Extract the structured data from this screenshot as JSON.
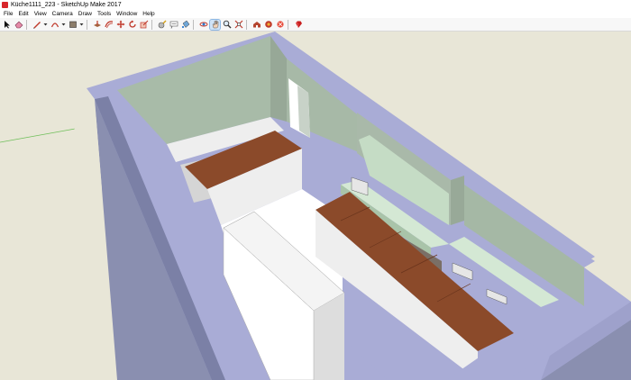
{
  "window": {
    "title": "Küche1111_223 - SketchUp Make 2017"
  },
  "menu": [
    "File",
    "Edit",
    "View",
    "Camera",
    "Draw",
    "Tools",
    "Window",
    "Help"
  ],
  "toolbar": {
    "tools": [
      {
        "name": "select-tool",
        "icon": "arrow-icon"
      },
      {
        "name": "eraser-tool",
        "icon": "eraser-icon"
      },
      {
        "name": "line-tool",
        "icon": "pencil-icon"
      },
      {
        "name": "line-tool-menu",
        "icon": "chevron-down-icon"
      },
      {
        "name": "arc-tool",
        "icon": "arc-icon"
      },
      {
        "name": "arc-tool-menu",
        "icon": "chevron-down-icon"
      },
      {
        "name": "rectangle-tool",
        "icon": "rectangle-icon"
      },
      {
        "name": "rectangle-tool-menu",
        "icon": "chevron-down-icon"
      },
      {
        "name": "push-pull-tool",
        "icon": "push-pull-icon"
      },
      {
        "name": "offset-tool",
        "icon": "offset-icon"
      },
      {
        "name": "move-tool",
        "icon": "move-icon"
      },
      {
        "name": "rotate-tool",
        "icon": "rotate-icon"
      },
      {
        "name": "scale-tool",
        "icon": "scale-icon"
      },
      {
        "name": "tape-measure-tool",
        "icon": "tape-icon"
      },
      {
        "name": "text-tool",
        "icon": "text-icon"
      },
      {
        "name": "paint-bucket-tool",
        "icon": "paint-bucket-icon"
      },
      {
        "name": "orbit-tool",
        "icon": "orbit-icon"
      },
      {
        "name": "pan-tool",
        "icon": "hand-icon"
      },
      {
        "name": "zoom-tool",
        "icon": "magnifier-icon"
      },
      {
        "name": "zoom-extents-tool",
        "icon": "zoom-extents-icon"
      },
      {
        "name": "3d-warehouse-button",
        "icon": "warehouse-icon"
      },
      {
        "name": "extension-warehouse-button",
        "icon": "extension-icon"
      },
      {
        "name": "layout-button",
        "icon": "layout-icon"
      },
      {
        "name": "ruby-console-button",
        "icon": "ruby-icon"
      }
    ],
    "active_tool": "pan-tool"
  },
  "colors": {
    "wall_outer": "#8d91b2",
    "wall_top": "#aeb1dc",
    "wall_inner": "#a9b9a9",
    "floor": "#ffffff",
    "counter_wood": "#8b4a2a",
    "sky": "#ffffff",
    "ground": "#e8e6d7"
  }
}
